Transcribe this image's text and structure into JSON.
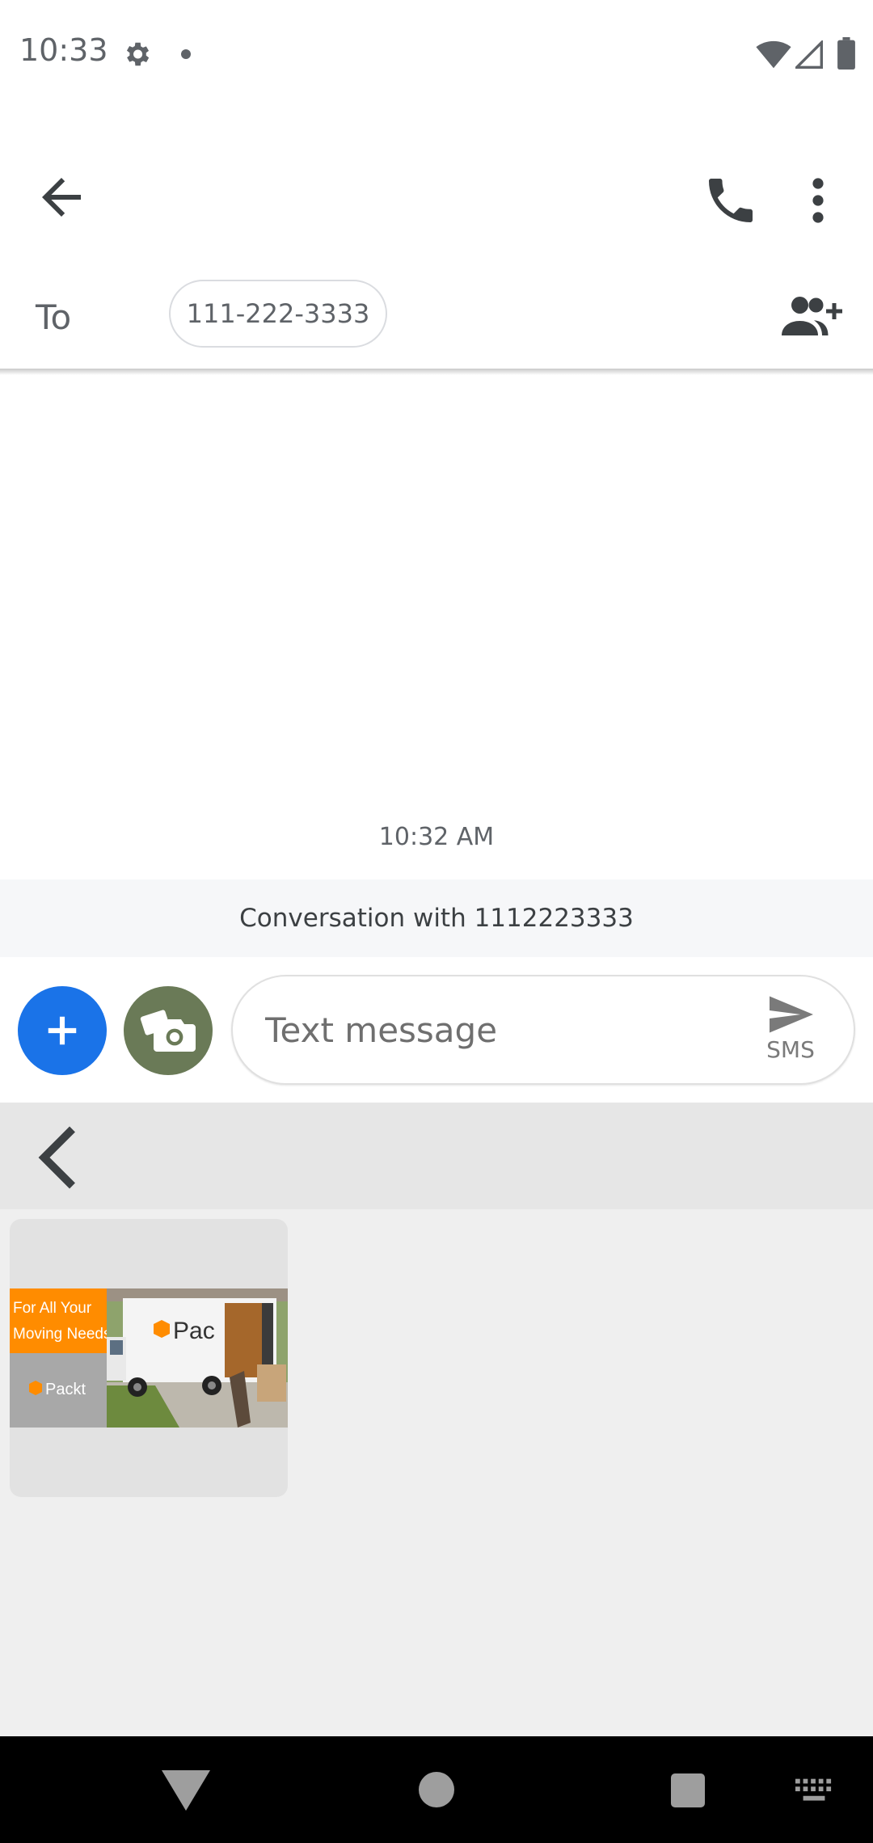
{
  "status_bar": {
    "time": "10:33",
    "icons": [
      "gear-icon",
      "notification-dot",
      "wifi-icon",
      "signal-icon",
      "battery-icon"
    ]
  },
  "toolbar": {
    "icons": [
      "back-arrow-icon",
      "phone-icon",
      "more-vert-icon"
    ]
  },
  "recipient": {
    "to_label": "To",
    "chip_text": "111-222-3333",
    "add_contact_icon": "add-person-icon"
  },
  "conversation": {
    "timestamp": "10:32 AM",
    "banner": "Conversation with 1112223333"
  },
  "compose": {
    "add_icon": "plus-icon",
    "camera_icon": "camera-icon",
    "placeholder": "Text message",
    "send_icon": "send-icon",
    "send_label": "SMS"
  },
  "media_picker": {
    "back_icon": "chevron-left-icon",
    "thumbnail": {
      "banner_line1": "For All Your",
      "banner_line2": "Moving Needs",
      "brand": "Packt",
      "truck_text": "Pac"
    }
  },
  "nav_bar": {
    "icons": [
      "nav-back-icon",
      "nav-home-icon",
      "nav-recents-icon",
      "keyboard-icon"
    ]
  },
  "colors": {
    "accent_blue": "#1a73e8",
    "camera_button": "#6a7a57",
    "brand_orange": "#ff8c00"
  }
}
